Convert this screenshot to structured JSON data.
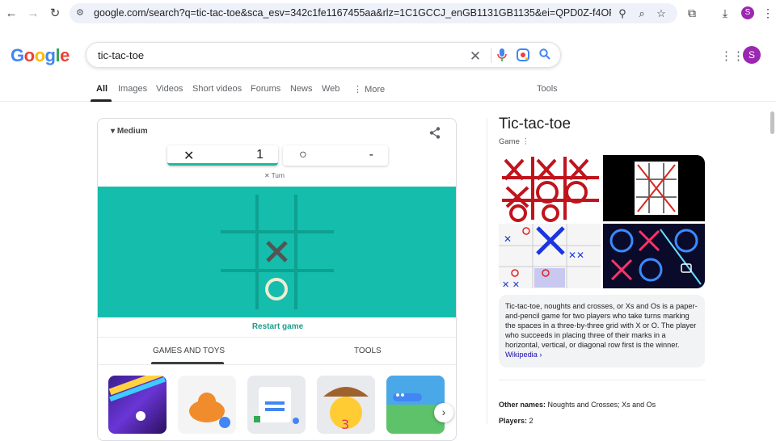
{
  "browser": {
    "url": "google.com/search?q=tic-tac-toe&sca_esv=342c1fe1167455aa&rlz=1C1GCCJ_enGB1131GB1135&ei=QPD0Z-f4OPyfhbIPx9z52A0&oq...",
    "profile_initial": "S"
  },
  "logo": {
    "letters": [
      "G",
      "o",
      "o",
      "g",
      "l",
      "e"
    ],
    "colors": [
      "#4285f4",
      "#ea4335",
      "#fbbc05",
      "#4285f4",
      "#34a853",
      "#ea4335"
    ]
  },
  "search": {
    "query": "tic-tac-toe"
  },
  "tabs": [
    {
      "label": "All"
    },
    {
      "label": "Images"
    },
    {
      "label": "Videos"
    },
    {
      "label": "Short videos"
    },
    {
      "label": "Forums"
    },
    {
      "label": "News"
    },
    {
      "label": "Web"
    },
    {
      "label": "More"
    },
    {
      "label": "Tools"
    }
  ],
  "game": {
    "difficulty": "Medium",
    "score_x_mark": "✕",
    "score_x": "1",
    "score_o_mark": "○",
    "score_o": "-",
    "turn": "✕ Turn",
    "restart": "Restart game",
    "section_tabs": [
      "GAMES AND TOYS",
      "TOOLS"
    ],
    "board": [
      "",
      "",
      "",
      "",
      "X",
      "",
      "",
      "O",
      ""
    ]
  },
  "knowledge_panel": {
    "title": "Tic-tac-toe",
    "subtitle": "Game ⋮",
    "description": "Tic-tac-toe, noughts and crosses, or Xs and Os is a paper-and-pencil game for two players who take turns marking the spaces in a three-by-three grid with X or O. The player who succeeds in placing three of their marks in a horizontal, vertical, or diagonal row first is the winner.",
    "wiki_link": "Wikipedia ›",
    "facts": [
      {
        "label": "Other names:",
        "value": "Noughts and Crosses; Xs and Os"
      },
      {
        "label": "Players:",
        "value": "2"
      }
    ]
  },
  "colors": {
    "teal": "#14bdac",
    "board_line": "#0da192",
    "x_mark": "#545454",
    "o_mark": "#f2ebd3"
  }
}
